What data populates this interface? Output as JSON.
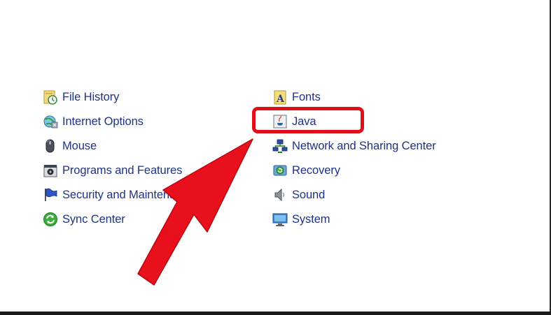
{
  "control_panel": {
    "left_column": [
      {
        "label": "File History",
        "icon": "file-history-icon"
      },
      {
        "label": "Internet Options",
        "icon": "internet-options-icon"
      },
      {
        "label": "Mouse",
        "icon": "mouse-icon"
      },
      {
        "label": "Programs and Features",
        "icon": "programs-features-icon"
      },
      {
        "label": "Security and Maintenance",
        "icon": "security-flag-icon"
      },
      {
        "label": "Sync Center",
        "icon": "sync-center-icon"
      }
    ],
    "right_column": [
      {
        "label": "Fonts",
        "icon": "fonts-icon"
      },
      {
        "label": "Java",
        "icon": "java-icon"
      },
      {
        "label": "Network and Sharing Center",
        "icon": "network-icon"
      },
      {
        "label": "Recovery",
        "icon": "recovery-icon"
      },
      {
        "label": "Sound",
        "icon": "sound-icon"
      },
      {
        "label": "System",
        "icon": "system-icon"
      }
    ]
  },
  "annotation": {
    "highlight_color": "#e0101a",
    "arrow_color": "#e8101c",
    "highlight_target": "Java"
  },
  "colors": {
    "link_text": "#1e3287",
    "background": "#ffffff"
  }
}
